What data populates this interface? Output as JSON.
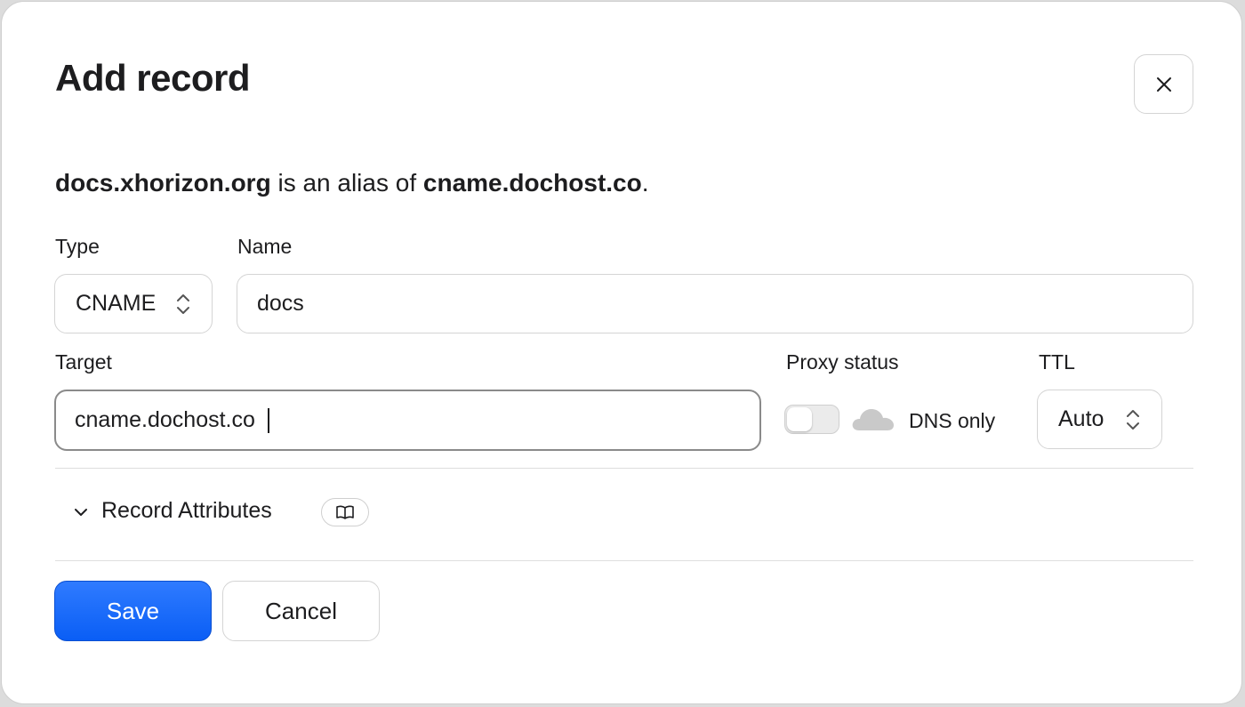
{
  "dialog": {
    "title": "Add record",
    "close_icon": "close-icon"
  },
  "summary": {
    "alias_name": "docs.xhorizon.org",
    "connector": " is an alias of ",
    "target": "cname.dochost.co",
    "end": "."
  },
  "form": {
    "type_label": "Type",
    "type_value": "CNAME",
    "name_label": "Name",
    "name_value": "docs",
    "target_label": "Target",
    "target_value": "cname.dochost.co",
    "proxy_label": "Proxy status",
    "proxy_enabled": false,
    "proxy_state_text": "DNS only",
    "ttl_label": "TTL",
    "ttl_value": "Auto"
  },
  "attributes": {
    "label": "Record Attributes",
    "doc_icon": "book-icon"
  },
  "actions": {
    "save_label": "Save",
    "cancel_label": "Cancel"
  },
  "colors": {
    "primary": "#0a5ef5",
    "border": "#d4d4d4",
    "focus_border": "#8a8a8a"
  }
}
